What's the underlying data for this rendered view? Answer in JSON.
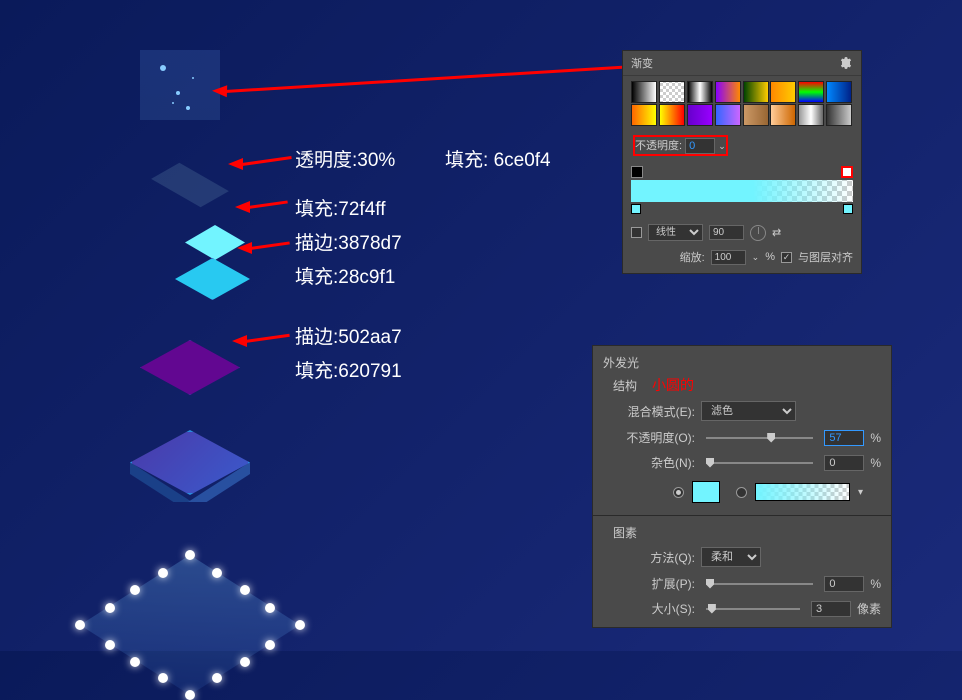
{
  "annotations": {
    "opacity30": "透明度:30%",
    "fill_label": "填充:",
    "fill_6ce0f4": "6ce0f4",
    "fill_72f4ff": "填充:72f4ff",
    "stroke_3878d7": "描边:3878d7",
    "fill_28c9f1": "填充:28c9f1",
    "stroke_502aa7": "描边:502aa7",
    "fill_620791": "填充:620791"
  },
  "gradient_panel": {
    "title": "渐变",
    "opacity_label": "不透明度:",
    "opacity_value": "0",
    "style_linear": "线性",
    "angle_value": "90",
    "scale_label": "缩放:",
    "scale_value": "100",
    "percent": "%",
    "align_label": "与图层对齐",
    "swatches": [
      "linear-gradient(90deg,#000,#fff)",
      "repeating-conic-gradient(#ccc 0% 25%, #fff 0% 50%) 50% / 6px 6px",
      "linear-gradient(90deg,#000,#fff,#000)",
      "linear-gradient(90deg,#8800ff,#ff8800)",
      "linear-gradient(90deg,#004400,#ffcc00)",
      "linear-gradient(90deg,#ff8800,#ffcc00)",
      "linear-gradient(180deg,#ff0000,#00ff00,#0000ff)",
      "linear-gradient(90deg,#0088ff,#002288)",
      "linear-gradient(90deg,#ff6600,#ffff00)",
      "linear-gradient(90deg,#ffff00,#ff0000)",
      "linear-gradient(90deg,#6600cc,#9900ff)",
      "linear-gradient(90deg,#3366ff,#cc66ff)",
      "linear-gradient(90deg,#cc9966,#996633)",
      "linear-gradient(90deg,#ffcc99,#cc6600)",
      "linear-gradient(90deg,#999999,#ffffff,#666666)",
      "linear-gradient(90deg,#333,#ccc)"
    ]
  },
  "glow_panel": {
    "title": "外发光",
    "structure_label": "结构",
    "red_note": "小圆的",
    "blend_mode_label": "混合模式(E):",
    "blend_mode_value": "滤色",
    "opacity_label": "不透明度(O):",
    "opacity_value": "57",
    "noise_label": "杂色(N):",
    "noise_value": "0",
    "elements_label": "图素",
    "method_label": "方法(Q):",
    "method_value": "柔和",
    "spread_label": "扩展(P):",
    "spread_value": "0",
    "size_label": "大小(S):",
    "size_value": "3",
    "percent": "%",
    "pixel": "像素",
    "glow_color": "#72f4ff"
  }
}
